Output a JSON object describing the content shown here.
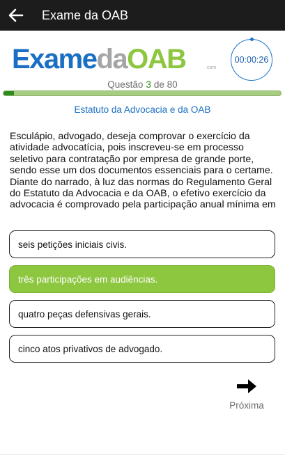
{
  "appbar": {
    "title": "Exame da OAB",
    "back_icon": "arrow-left-icon"
  },
  "logo": {
    "text_part1": "Exame",
    "text_part2": "da",
    "text_part3": "OAB",
    "suffix": ".com",
    "colors": {
      "blue": "#1a6fc4",
      "gray": "#a0a0a0",
      "green": "#8dc63f"
    }
  },
  "timer": {
    "value": "00:00:26"
  },
  "question_counter": {
    "label": "Questão",
    "current": "3",
    "separator": "de",
    "total": "80"
  },
  "progress": {
    "fraction": 0.0375
  },
  "subject": "Estatuto da Advocacia e da OAB",
  "question_text": "Esculápio, advogado, deseja comprovar o exercício da atividade advocatícia, pois inscreveu-se em processo seletivo para contratação por empresa de grande porte, sendo esse um dos documentos essenciais para o certame. Diante do narrado, à luz das normas do Regulamento Geral do Estatuto da Advocacia e da OAB, o efetivo exercício da advocacia é comprovado pela participação anual mínima em",
  "options": [
    {
      "label": "seis petições iniciais civis.",
      "selected": false
    },
    {
      "label": "três participações em audiências.",
      "selected": true
    },
    {
      "label": "quatro peças defensivas gerais.",
      "selected": false
    },
    {
      "label": "cinco atos privativos de advogado.",
      "selected": false
    }
  ],
  "next": {
    "label": "Próxima",
    "icon": "arrow-right-icon"
  },
  "colors": {
    "appbar": "#1c1c1c",
    "selected_option": "#8dc63f",
    "progress_fill": "#2e8b1f",
    "subject_text": "#1a6fc4"
  }
}
